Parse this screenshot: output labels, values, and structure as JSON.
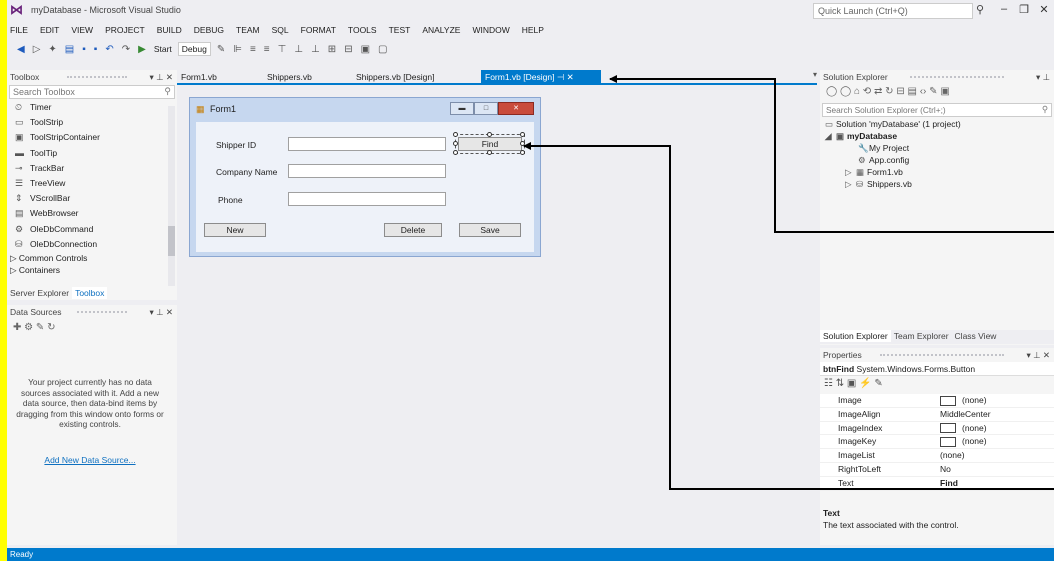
{
  "window": {
    "title": "myDatabase - Microsoft Visual Studio",
    "quick_launch_placeholder": "Quick Launch (Ctrl+Q)"
  },
  "menu": [
    "FILE",
    "EDIT",
    "VIEW",
    "PROJECT",
    "BUILD",
    "DEBUG",
    "TEAM",
    "SQL",
    "FORMAT",
    "TOOLS",
    "TEST",
    "ANALYZE",
    "WINDOW",
    "HELP"
  ],
  "toolbar": {
    "start_label": "Start",
    "config_value": "Debug"
  },
  "toolbox": {
    "title": "Toolbox",
    "search_placeholder": "Search Toolbox",
    "items": [
      "Timer",
      "ToolStrip",
      "ToolStripContainer",
      "ToolTip",
      "TrackBar",
      "TreeView",
      "VScrollBar",
      "WebBrowser",
      "OleDbCommand",
      "OleDbConnection"
    ],
    "groups": [
      "Common Controls",
      "Containers"
    ],
    "tabs": [
      "Server Explorer",
      "Toolbox"
    ]
  },
  "data_sources": {
    "title": "Data Sources",
    "message": "Your project currently has no data sources associated with it. Add a new data source, then data-bind items by dragging from this window onto forms or existing controls.",
    "link": "Add New Data Source..."
  },
  "doc_tabs": [
    "Form1.vb",
    "Shippers.vb",
    "Shippers.vb [Design]",
    "Form1.vb [Design]"
  ],
  "form": {
    "title": "Form1",
    "labels": {
      "shipper_id": "Shipper ID",
      "company": "Company Name",
      "phone": "Phone"
    },
    "buttons": {
      "find": "Find",
      "new": "New",
      "delete": "Delete",
      "save": "Save"
    }
  },
  "solution_explorer": {
    "title": "Solution Explorer",
    "search_placeholder": "Search Solution Explorer (Ctrl+;)",
    "solution": "Solution 'myDatabase' (1 project)",
    "project": "myDatabase",
    "items": [
      "My Project",
      "App.config",
      "Form1.vb",
      "Shippers.vb"
    ],
    "tabs": [
      "Solution Explorer",
      "Team Explorer",
      "Class View"
    ]
  },
  "properties": {
    "title": "Properties",
    "object_name": "btnFind",
    "object_type": "System.Windows.Forms.Button",
    "rows": [
      {
        "name": "Image",
        "value": "(none)"
      },
      {
        "name": "ImageAlign",
        "value": "MiddleCenter"
      },
      {
        "name": "ImageIndex",
        "value": "(none)"
      },
      {
        "name": "ImageKey",
        "value": "(none)"
      },
      {
        "name": "ImageList",
        "value": "(none)"
      },
      {
        "name": "RightToLeft",
        "value": "No"
      },
      {
        "name": "Text",
        "value": "Find"
      }
    ],
    "desc_title": "Text",
    "desc_text": "The text associated with the control."
  },
  "status": "Ready",
  "colors": {
    "accent": "#007acc",
    "highlight_border": "#ffff00",
    "arrow": "#000000"
  }
}
